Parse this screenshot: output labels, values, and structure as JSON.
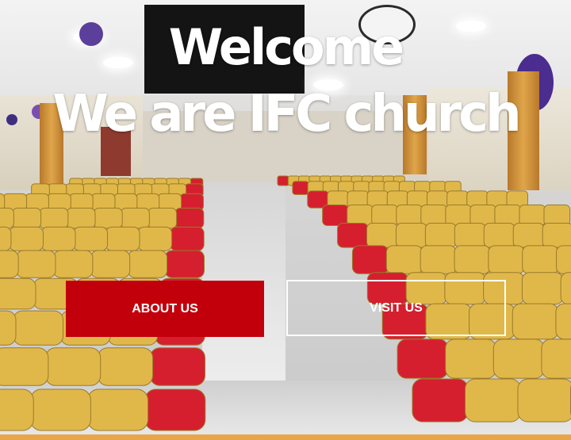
{
  "hero": {
    "title_line1": "Welcome",
    "title_line2": "We are IFC church",
    "background_image": "church-hall-with-yellow-and-red-chairs"
  },
  "buttons": {
    "about_label": "ABOUT US",
    "visit_label": "VISIT US"
  },
  "colors": {
    "primary_red": "#c2000c",
    "text_white": "#ffffff",
    "chair_gold": "#e0b84a",
    "chair_red": "#d51f2e",
    "accent_orange": "#e8a64a"
  }
}
